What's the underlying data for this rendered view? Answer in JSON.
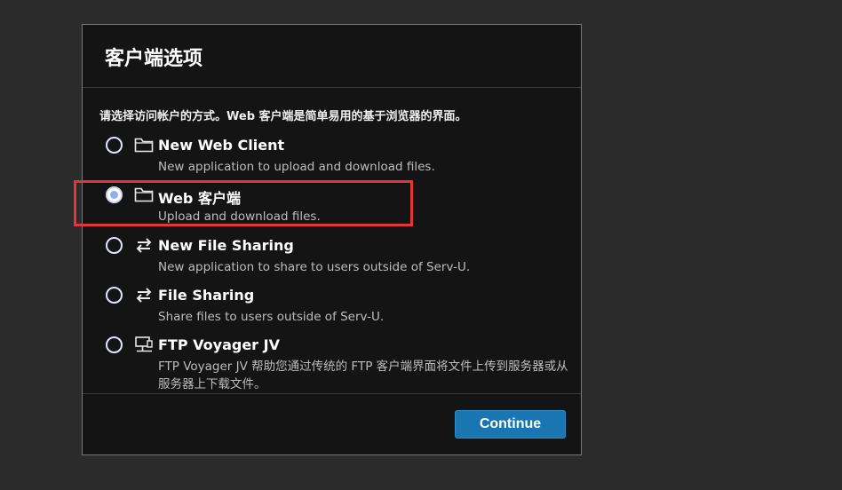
{
  "dialog": {
    "title": "客户端选项",
    "instruction": "请选择访问帐户的方式。Web 客户端是简单易用的基于浏览器的界面。",
    "continue_label": "Continue"
  },
  "options": [
    {
      "label": "New Web Client",
      "description": "New application to upload and download files.",
      "icon": "folder-icon",
      "selected": false
    },
    {
      "label": "Web 客户端",
      "description": "Upload and download files.",
      "icon": "folder-icon",
      "selected": true
    },
    {
      "label": "New File Sharing",
      "description": "New application to share to users outside of Serv-U.",
      "icon": "swap-arrows-icon",
      "selected": false
    },
    {
      "label": "File Sharing",
      "description": "Share files to users outside of Serv-U.",
      "icon": "swap-arrows-icon",
      "selected": false
    },
    {
      "label": "FTP Voyager JV",
      "description": "FTP Voyager JV 帮助您通过传统的 FTP 客户端界面将文件上传到服务器或从服务器上下载文件。",
      "icon": "network-computer-icon",
      "selected": false
    }
  ],
  "colors": {
    "accent": "#1a76b0",
    "highlight": "#e5343a",
    "background": "#2b2b2b",
    "dialog": "#141414"
  }
}
